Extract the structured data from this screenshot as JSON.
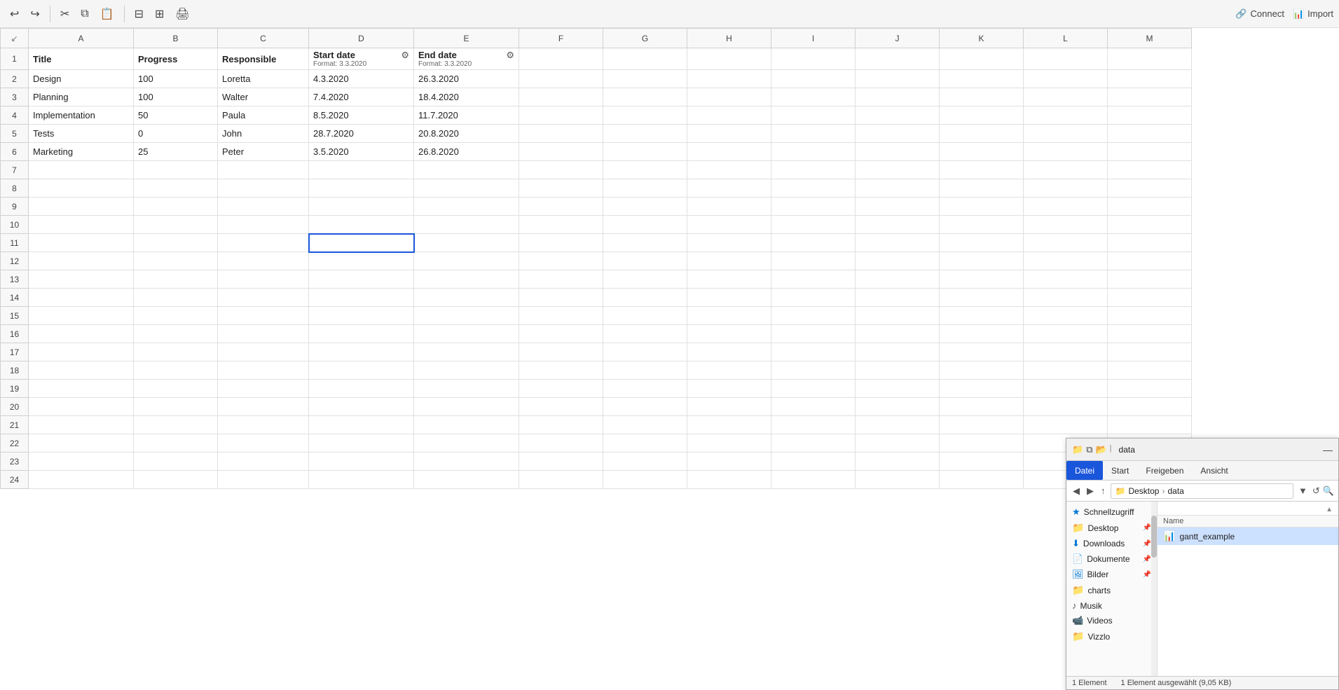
{
  "toolbar": {
    "undo_icon": "↩",
    "redo_icon": "↪",
    "cut_icon": "✂",
    "copy_icon": "⧉",
    "paste_icon": "📋",
    "format_icon": "⊟",
    "table_icon": "⊞",
    "print_icon": "🖨",
    "connect_label": "Connect",
    "import_label": "Import"
  },
  "spreadsheet": {
    "col_headers": [
      "",
      "A",
      "B",
      "C",
      "D",
      "E",
      "F",
      "G",
      "H",
      "I",
      "J",
      "K",
      "L",
      "M"
    ],
    "row_count": 24,
    "header_row": {
      "row_num": 1,
      "cells": {
        "A": "Title",
        "B": "Progress",
        "C": "Responsible",
        "D_title": "Start date",
        "D_format": "Format: 3.3.2020",
        "E_title": "End date",
        "E_format": "Format: 3.3.2020"
      }
    },
    "data_rows": [
      {
        "row": 2,
        "A": "Design",
        "B": "100",
        "C": "Loretta",
        "D": "4.3.2020",
        "E": "26.3.2020"
      },
      {
        "row": 3,
        "A": "Planning",
        "B": "100",
        "C": "Walter",
        "D": "7.4.2020",
        "E": "18.4.2020"
      },
      {
        "row": 4,
        "A": "Implementation",
        "B": "50",
        "C": "Paula",
        "D": "8.5.2020",
        "E": "11.7.2020"
      },
      {
        "row": 5,
        "A": "Tests",
        "B": "0",
        "C": "John",
        "D": "28.7.2020",
        "E": "20.8.2020"
      },
      {
        "row": 6,
        "A": "Marketing",
        "B": "25",
        "C": "Peter",
        "D": "3.5.2020",
        "E": "26.8.2020"
      }
    ],
    "selected_cell": {
      "row": 11,
      "col": "D"
    }
  },
  "file_explorer": {
    "title": "data",
    "tabs": [
      "Datei",
      "Start",
      "Freigeben",
      "Ansicht"
    ],
    "active_tab": "Datei",
    "address": {
      "breadcrumb": "Desktop › data",
      "desktop": "Desktop",
      "folder": "data"
    },
    "col_header": "Name",
    "sidebar": {
      "items": [
        {
          "id": "schnellzugriff",
          "label": "Schnellzugriff",
          "icon": "star",
          "pin": false
        },
        {
          "id": "desktop",
          "label": "Desktop",
          "icon": "folder-blue",
          "pin": true
        },
        {
          "id": "downloads",
          "label": "Downloads",
          "icon": "downloads",
          "pin": true
        },
        {
          "id": "dokumente",
          "label": "Dokumente",
          "icon": "docs",
          "pin": true
        },
        {
          "id": "bilder",
          "label": "Bilder",
          "icon": "pics",
          "pin": true
        },
        {
          "id": "charts",
          "label": "charts",
          "icon": "folder-yellow",
          "pin": false
        },
        {
          "id": "musik",
          "label": "Musik",
          "icon": "music",
          "pin": false
        },
        {
          "id": "videos",
          "label": "Videos",
          "icon": "video",
          "pin": false
        },
        {
          "id": "vizzlo",
          "label": "Vizzlo",
          "icon": "folder-yellow",
          "pin": false
        }
      ]
    },
    "files": [
      {
        "id": "gantt_example",
        "name": "gantt_example",
        "icon": "excel",
        "selected": true
      }
    ],
    "statusbar": {
      "count": "1 Element",
      "selected": "1 Element ausgewählt (9,05 KB)"
    }
  }
}
